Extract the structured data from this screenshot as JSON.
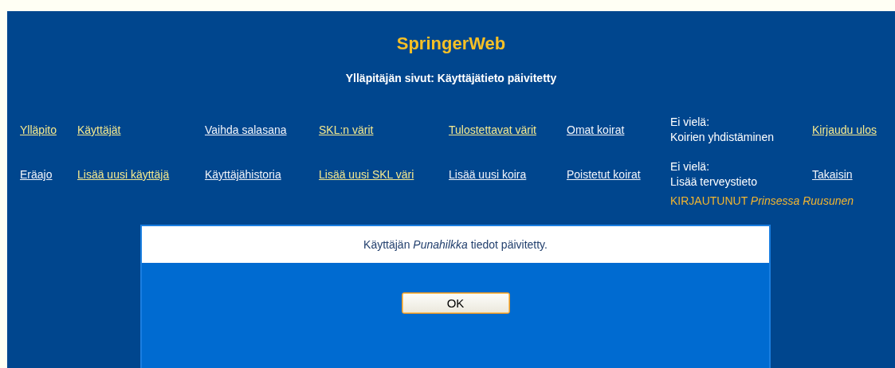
{
  "header": {
    "title": "SpringerWeb",
    "subtitle": "Ylläpitäjän sivut: Käyttäjätieto päivitetty"
  },
  "nav_rows": [
    [
      {
        "kind": "link",
        "label": "Ylläpito",
        "visited": false
      },
      {
        "kind": "link",
        "label": "Käyttäjät",
        "visited": false
      },
      {
        "kind": "link",
        "label": "Vaihda salasana",
        "visited": true
      },
      {
        "kind": "link",
        "label": "SKL:n värit",
        "visited": false
      },
      {
        "kind": "link",
        "label": "Tulostettavat värit",
        "visited": false
      },
      {
        "kind": "link",
        "label": "Omat koirat",
        "visited": true
      },
      {
        "kind": "note",
        "lines": [
          "Ei vielä:",
          "Koirien yhdistäminen"
        ]
      },
      {
        "kind": "link",
        "label": "Kirjaudu ulos",
        "visited": false
      }
    ],
    [
      {
        "kind": "link",
        "label": "Eräajo",
        "visited": true
      },
      {
        "kind": "link",
        "label": "Lisää uusi käyttäjä",
        "visited": false
      },
      {
        "kind": "link",
        "label": "Käyttäjähistoria",
        "visited": true
      },
      {
        "kind": "link",
        "label": "Lisää uusi SKL väri",
        "visited": false
      },
      {
        "kind": "link",
        "label": "Lisää uusi koira",
        "visited": true
      },
      {
        "kind": "link",
        "label": "Poistetut koirat",
        "visited": true
      },
      {
        "kind": "note",
        "lines": [
          "Ei vielä:",
          "Lisää terveystieto"
        ]
      },
      {
        "kind": "link",
        "label": "Takaisin",
        "visited": true
      }
    ]
  ],
  "login_status": "KIRJAUTUNUT *Prinsessa Ruusunen*",
  "dialog": {
    "message": "Käyttäjän *Punahilkka* tiedot päivitetty.",
    "button": "OK"
  }
}
